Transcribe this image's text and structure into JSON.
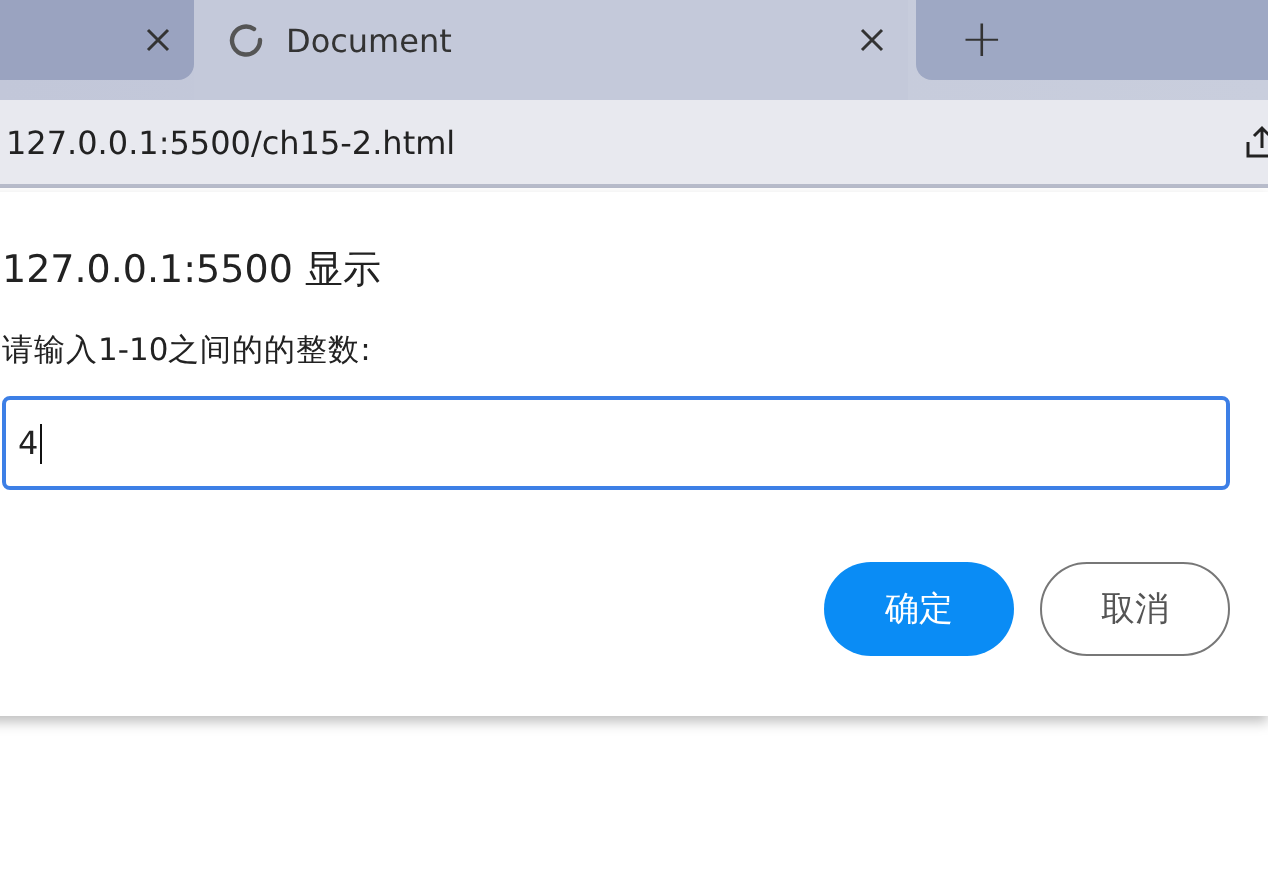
{
  "tabs": [
    {
      "selected": false,
      "loading": false
    },
    {
      "label": "Document",
      "selected": true,
      "loading": true
    }
  ],
  "new_tab": "+",
  "address_bar": {
    "url": "127.0.0.1:5500/ch15-2.html"
  },
  "dialog": {
    "title": "127.0.0.1:5500 显示",
    "message": "请输入1-10之间的的整数:",
    "input": {
      "value": "4",
      "focused": true
    },
    "buttons": [
      {
        "label": "确定",
        "kind": "primary"
      },
      {
        "label": "取消",
        "kind": "secondary"
      }
    ]
  }
}
